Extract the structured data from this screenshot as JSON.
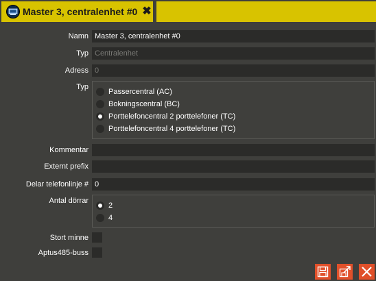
{
  "tab": {
    "title": "Master 3, centralenhet #0",
    "close_symbol": "✖",
    "icon": "central-unit-icon"
  },
  "form": {
    "name": {
      "label": "Namn",
      "value": "Master 3, centralenhet #0"
    },
    "type_text": {
      "label": "Typ",
      "placeholder": "Centralenhet"
    },
    "address": {
      "label": "Adress",
      "placeholder": "0"
    },
    "type_choice": {
      "label": "Typ",
      "options": [
        {
          "label": "Passercentral (AC)",
          "selected": false
        },
        {
          "label": "Bokningscentral (BC)",
          "selected": false
        },
        {
          "label": "Porttelefoncentral 2 porttelefoner (TC)",
          "selected": true
        },
        {
          "label": "Porttelefoncentral 4 porttelefoner (TC)",
          "selected": false
        }
      ]
    },
    "comment": {
      "label": "Kommentar",
      "value": ""
    },
    "external_prefix": {
      "label": "Externt prefix",
      "value": ""
    },
    "shared_line": {
      "label": "Delar telefonlinje #",
      "value": "0"
    },
    "doors": {
      "label": "Antal dörrar",
      "options": [
        {
          "label": "2",
          "selected": true
        },
        {
          "label": "4",
          "selected": false
        }
      ]
    },
    "large_memory": {
      "label": "Stort minne",
      "checked": false
    },
    "aptus_bus": {
      "label": "Aptus485-buss",
      "checked": false
    }
  },
  "toolbar": {
    "save_icon": "save-icon",
    "edit_icon": "edit-icon",
    "close_icon": "close-icon"
  },
  "colors": {
    "background": "#3f3f3c",
    "tab_accent": "#d8c300",
    "field_bg": "#2b2b29",
    "button_accent": "#e0502a"
  }
}
